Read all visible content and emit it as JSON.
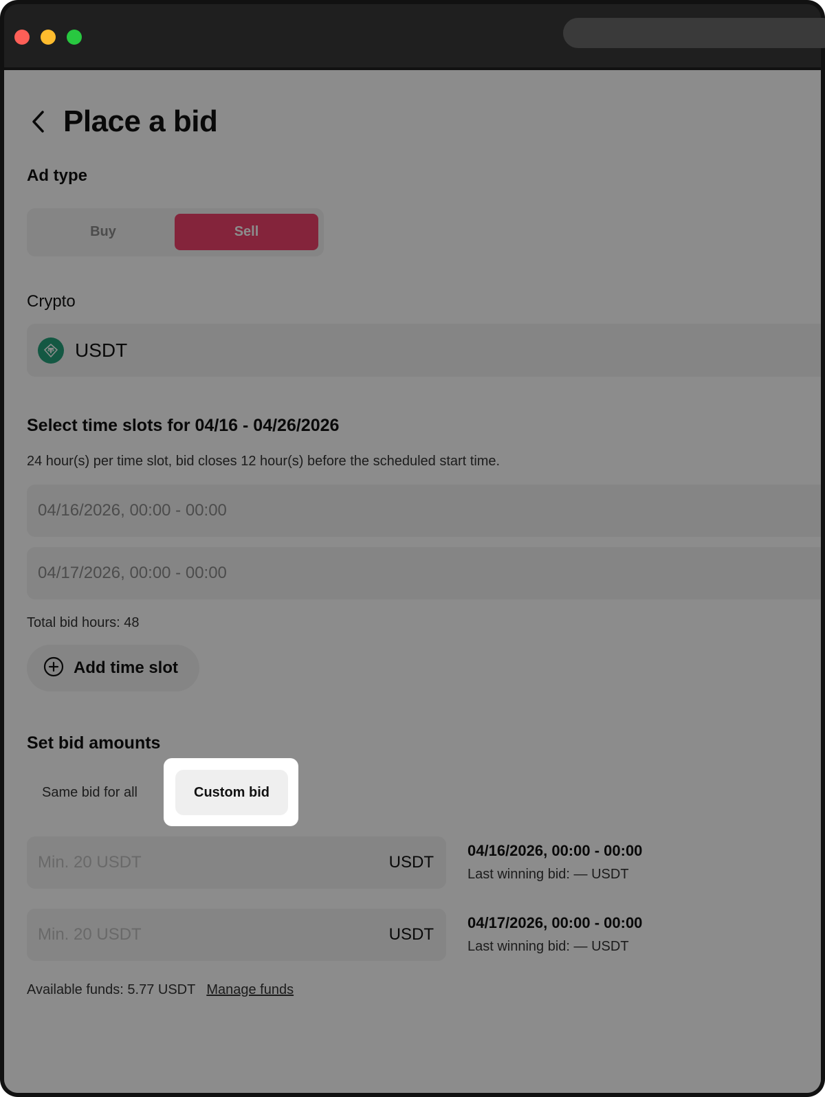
{
  "page": {
    "title": "Place a bid"
  },
  "ad_type": {
    "label": "Ad type",
    "options": [
      "Buy",
      "Sell"
    ],
    "selected": "Sell"
  },
  "crypto": {
    "label": "Crypto",
    "value": "USDT"
  },
  "time_slots": {
    "heading": "Select time slots for 04/16 - 04/26/2026",
    "hint": "24 hour(s) per time slot, bid closes 12 hour(s) before the scheduled start time.",
    "slots": [
      "04/16/2026, 00:00 - 00:00",
      "04/17/2026, 00:00 - 00:00"
    ],
    "total": "Total bid hours: 48",
    "add_label": "Add time slot"
  },
  "bid_amounts": {
    "heading": "Set bid amounts",
    "tab_same": "Same bid for all",
    "tab_custom": "Custom bid",
    "rows": [
      {
        "placeholder": "Min. 20 USDT",
        "unit": "USDT",
        "time": "04/16/2026, 00:00 - 00:00",
        "last": "Last winning bid: — USDT"
      },
      {
        "placeholder": "Min. 20 USDT",
        "unit": "USDT",
        "time": "04/17/2026, 00:00 - 00:00",
        "last": "Last winning bid: — USDT"
      }
    ],
    "funds": "Available funds: 5.77 USDT",
    "manage_funds": "Manage funds"
  },
  "colors": {
    "sell_accent": "#f0426c",
    "usdt_green": "#26a17b"
  }
}
